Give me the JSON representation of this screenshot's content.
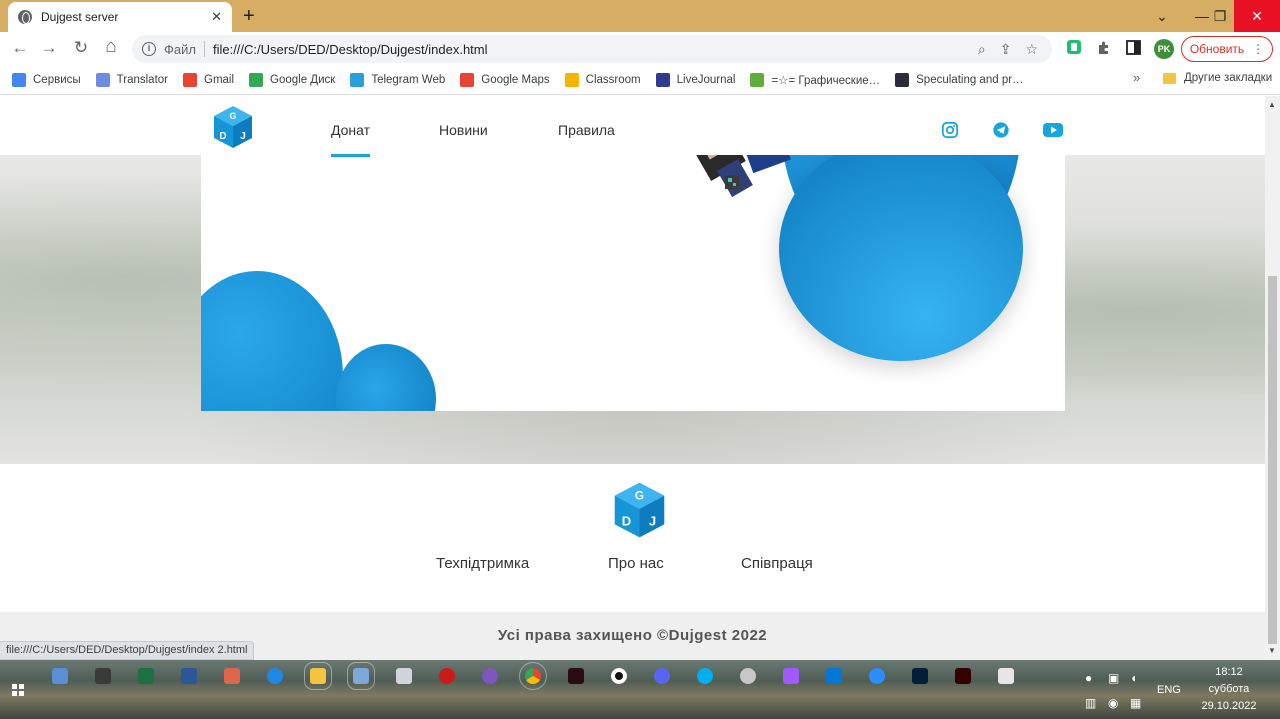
{
  "browser": {
    "tab_title": "Dujgest server",
    "tab_close": "✕",
    "new_tab": "+",
    "window": {
      "chevron": "⌄",
      "minimize": "—",
      "restore": "❐",
      "close": "✕"
    },
    "nav": {
      "back": "←",
      "forward": "→",
      "reload": "↻",
      "home": "⌂"
    },
    "address": {
      "scheme_label": "Файл",
      "url": "file:///C:/Users/DED/Desktop/Dujgest/index.html"
    },
    "profile_initials": "PK",
    "update_button": "Обновить",
    "update_menu": "⋮",
    "bookmarks": [
      {
        "label": "Сервисы",
        "icon": "apps-grid-icon",
        "color": "#4285f4"
      },
      {
        "label": "Translator",
        "icon": "translator-icon",
        "color": "#6b8cdf"
      },
      {
        "label": "Gmail",
        "icon": "gmail-icon",
        "color": "#ea4335"
      },
      {
        "label": "Google Диск",
        "icon": "google-drive-icon",
        "color": "#34a853"
      },
      {
        "label": "Telegram Web",
        "icon": "telegram-icon",
        "color": "#2aa0da"
      },
      {
        "label": "Google Maps",
        "icon": "google-maps-icon",
        "color": "#ea4335"
      },
      {
        "label": "Classroom",
        "icon": "classroom-icon",
        "color": "#f4b400"
      },
      {
        "label": "LiveJournal",
        "icon": "livejournal-icon",
        "color": "#2f3b8f"
      },
      {
        "label": "=☆= Графические…",
        "icon": "sprout-icon",
        "color": "#5fae3a"
      },
      {
        "label": "Speculating and pr…",
        "icon": "quora-icon",
        "color": "#2b2b3a"
      }
    ],
    "bookmarks_more": "»",
    "other_bookmarks": "Другие закладки",
    "status_url": "file:///C:/Users/DED/Desktop/Dujgest/index 2.html"
  },
  "site": {
    "logo_letters": {
      "top": "G",
      "left": "D",
      "right": "J"
    },
    "nav": [
      {
        "label": "Донат",
        "active": true
      },
      {
        "label": "Новини",
        "active": false
      },
      {
        "label": "Правила",
        "active": false
      }
    ],
    "social": [
      "instagram-icon",
      "telegram-icon",
      "youtube-icon"
    ],
    "accent_color": "#16a6dd",
    "footer_links": [
      "Техпідтримка",
      "Про нас",
      "Співпраця"
    ],
    "copyright": "Усі права захищено ©Dujgest 2022"
  },
  "taskbar": {
    "language": "ENG",
    "time": "18:12",
    "day": "суббота",
    "date": "29.10.2022"
  }
}
